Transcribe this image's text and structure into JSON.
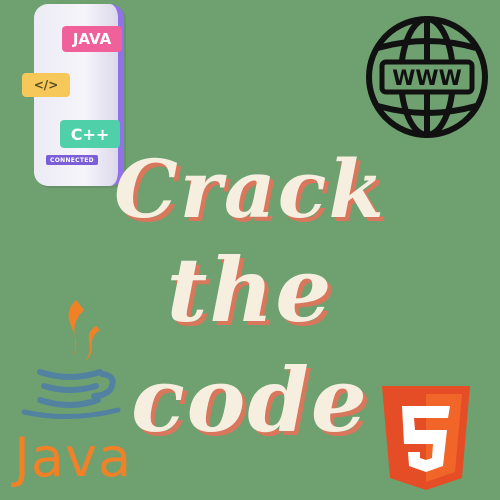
{
  "phone": {
    "tags": {
      "java": "JAVA",
      "code": "</>",
      "cpp": "C++",
      "connected": "CONNECTED"
    }
  },
  "globe": {
    "label": "WWW",
    "icon": "globe-www-icon"
  },
  "title": {
    "line1": "Crack",
    "line2": "the",
    "line3": "code"
  },
  "java": {
    "word": "Java",
    "icon": "java-coffee-cup-icon"
  },
  "html5": {
    "icon": "html5-shield-icon",
    "digit": "5"
  },
  "colors": {
    "background": "#6ea070",
    "title_text": "#f6efe0",
    "title_shadow": "#d9775c",
    "java_orange": "#f08127",
    "java_blue": "#5382a1",
    "html5_orange": "#e44d26",
    "phone_accent": "#8f72e8"
  }
}
